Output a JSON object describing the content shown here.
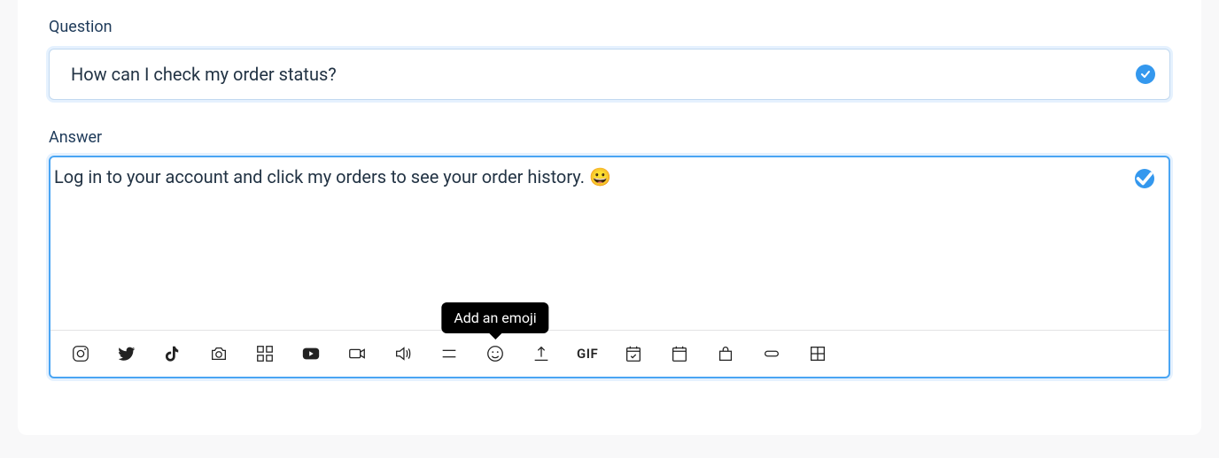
{
  "question": {
    "label": "Question",
    "value": "How can I check my order status?"
  },
  "answer": {
    "label": "Answer",
    "text": "Log in to your account and click my orders to see your order history. ",
    "emoji": "😀"
  },
  "tooltip": "Add an emoji",
  "toolbar": {
    "items": [
      "instagram",
      "twitter",
      "tiktok",
      "camera",
      "gallery",
      "youtube",
      "video",
      "audio",
      "spacer",
      "emoji",
      "upload",
      "gif",
      "event",
      "calendar",
      "store",
      "pill",
      "grid"
    ]
  }
}
